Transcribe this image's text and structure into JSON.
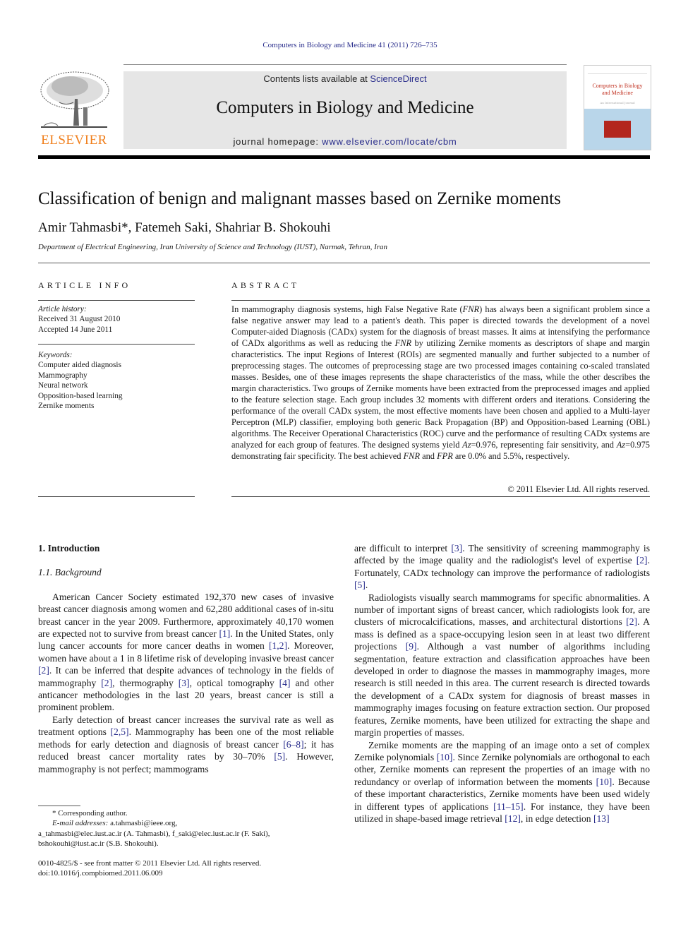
{
  "running_head": "Computers in Biology and Medicine 41 (2011) 726–735",
  "masthead": {
    "publisher": "ELSEVIER",
    "contents_prefix": "Contents lists available at ",
    "contents_link": "ScienceDirect",
    "journal_title": "Computers in Biology and Medicine",
    "homepage_prefix": "journal homepage: ",
    "homepage_link": "www.elsevier.com/locate/cbm",
    "cover_title_line1": "Computers in Biology",
    "cover_title_line2": "and Medicine",
    "cover_subtitle": "An International Journal"
  },
  "article": {
    "title": "Classification of benign and malignant masses based on Zernike moments",
    "authors": "Amir Tahmasbi*, Fatemeh Saki, Shahriar B. Shokouhi",
    "affiliation": "Department of Electrical Engineering, Iran University of Science and Technology (IUST), Narmak, Tehran, Iran"
  },
  "article_info": {
    "heading": "ARTICLE INFO",
    "history_label": "Article history:",
    "received": "Received 31 August 2010",
    "accepted": "Accepted 14 June 2011",
    "keywords_label": "Keywords:",
    "keywords": [
      "Computer aided diagnosis",
      "Mammography",
      "Neural network",
      "Opposition-based learning",
      "Zernike moments"
    ]
  },
  "abstract": {
    "heading": "ABSTRACT",
    "parts": [
      "In mammography diagnosis systems, high False Negative Rate (",
      "FNR",
      ") has always been a significant problem since a false negative answer may lead to a patient's death. This paper is directed towards the development of a novel Computer-aided Diagnosis (CADx) system for the diagnosis of breast masses. It aims at intensifying the performance of CADx algorithms as well as reducing the ",
      "FNR",
      " by utilizing Zernike moments as descriptors of shape and margin characteristics. The input Regions of Interest (ROIs) are segmented manually and further subjected to a number of preprocessing stages. The outcomes of preprocessing stage are two processed images containing co-scaled translated masses. Besides, one of these images represents the shape characteristics of the mass, while the other describes the margin characteristics. Two groups of Zernike moments have been extracted from the preprocessed images and applied to the feature selection stage. Each group includes 32 moments with different orders and iterations. Considering the performance of the overall CADx system, the most effective moments have been chosen and applied to a Multi-layer Perceptron (MLP) classifier, employing both generic Back Propagation (BP) and Opposition-based Learning (OBL) algorithms. The Receiver Operational Characteristics (ROC) curve and the performance of resulting CADx systems are analyzed for each group of features. The designed systems yield ",
      "Az",
      "=0.976, representing fair sensitivity, and ",
      "Az",
      "=0.975 demonstrating fair specificity. The best achieved ",
      "FNR",
      " and ",
      "FPR",
      " are 0.0% and 5.5%, respectively."
    ],
    "copyright": "© 2011 Elsevier Ltd. All rights reserved."
  },
  "body": {
    "section1_heading": "1.  Introduction",
    "section11_heading": "1.1.  Background",
    "left_paragraphs": [
      [
        {
          "t": "American Cancer Society estimated 192,370 new cases of invasive breast cancer diagnosis among women and 62,280 additional cases of in-situ breast cancer in the year 2009. Furthermore, approximately 40,170 women are expected not to survive from breast cancer "
        },
        {
          "c": "[1]"
        },
        {
          "t": ". In the United States, only lung cancer accounts for more cancer deaths in women "
        },
        {
          "c": "[1,2]"
        },
        {
          "t": ". Moreover, women have about a 1 in 8 lifetime risk of developing invasive breast cancer "
        },
        {
          "c": "[2]"
        },
        {
          "t": ". It can be inferred that despite advances of technology in the fields of mammography "
        },
        {
          "c": "[2]"
        },
        {
          "t": ", thermography "
        },
        {
          "c": "[3]"
        },
        {
          "t": ", optical tomography "
        },
        {
          "c": "[4]"
        },
        {
          "t": " and other anticancer methodologies in the last 20 years, breast cancer is still a prominent problem."
        }
      ],
      [
        {
          "t": "Early detection of breast cancer increases the survival rate as well as treatment options "
        },
        {
          "c": "[2,5]"
        },
        {
          "t": ". Mammography has been one of the most reliable methods for early detection and diagnosis of breast cancer "
        },
        {
          "c": "[6–8]"
        },
        {
          "t": "; it has reduced breast cancer mortality rates by 30–70% "
        },
        {
          "c": "[5]"
        },
        {
          "t": ". However, mammography is not perfect; mammograms"
        }
      ]
    ],
    "right_paragraphs": [
      [
        {
          "t": "are difficult to interpret "
        },
        {
          "c": "[3]"
        },
        {
          "t": ". The sensitivity of screening mammography is affected by the image quality and the radiologist's level of expertise "
        },
        {
          "c": "[2]"
        },
        {
          "t": ". Fortunately, CADx technology can improve the performance of radiologists "
        },
        {
          "c": "[5]"
        },
        {
          "t": "."
        }
      ],
      [
        {
          "t": "Radiologists visually search mammograms for specific abnormalities. A number of important signs of breast cancer, which radiologists look for, are clusters of microcalcifications, masses, and architectural distortions "
        },
        {
          "c": "[2]"
        },
        {
          "t": ". A mass is defined as a space-occupying lesion seen in at least two different projections "
        },
        {
          "c": "[9]"
        },
        {
          "t": ". Although a vast number of algorithms including segmentation, feature extraction and classification approaches have been developed in order to diagnose the masses in mammography images, more research is still needed in this area. The current research is directed towards the development of a CADx system for diagnosis of breast masses in mammography images focusing on feature extraction section. Our proposed features, Zernike moments, have been utilized for extracting the shape and margin properties of masses."
        }
      ],
      [
        {
          "t": "Zernike moments are the mapping of an image onto a set of complex Zernike polynomials "
        },
        {
          "c": "[10]"
        },
        {
          "t": ". Since Zernike polynomials are orthogonal to each other, Zernike moments can represent the properties of an image with no redundancy or overlap of information between the moments "
        },
        {
          "c": "[10]"
        },
        {
          "t": ". Because of these important characteristics, Zernike moments have been used widely in different types of applications "
        },
        {
          "c": "[11–15]"
        },
        {
          "t": ". For instance, they have been utilized in shape-based image retrieval "
        },
        {
          "c": "[12]"
        },
        {
          "t": ", in edge detection "
        },
        {
          "c": "[13]"
        }
      ]
    ]
  },
  "footnotes": {
    "corresponding": "* Corresponding author.",
    "email_label": "E-mail addresses:",
    "email_line1": " a.tahmasbi@ieee.org,",
    "email_line2": "a_tahmasbi@elec.iust.ac.ir (A. Tahmasbi), f_saki@elec.iust.ac.ir (F. Saki),",
    "email_line3": "bshokouhi@iust.ac.ir (S.B. Shokouhi).",
    "issn": "0010-4825/$ - see front matter © 2011 Elsevier Ltd. All rights reserved.",
    "doi": "doi:10.1016/j.compbiomed.2011.06.009"
  },
  "colors": {
    "link": "#2a2e8c",
    "elsevier_orange": "#f07f1c",
    "masthead_gray": "#e6e6e6"
  }
}
